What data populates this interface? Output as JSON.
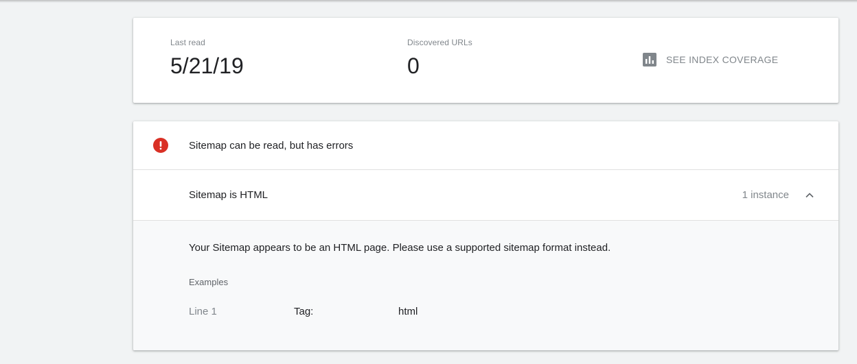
{
  "summary": {
    "last_read_label": "Last read",
    "last_read_value": "5/21/19",
    "discovered_label": "Discovered URLs",
    "discovered_value": "0",
    "coverage_link_label": "SEE INDEX COVERAGE",
    "coverage_icon": "bar-chart-icon"
  },
  "status": {
    "icon": "error-icon",
    "text": "Sitemap can be read, but has errors",
    "error_color": "#d93025"
  },
  "issue": {
    "title": "Sitemap is HTML",
    "count": "1 instance",
    "expanded": true,
    "toggle_icon": "chevron-up-icon",
    "description": "Your Sitemap appears to be an HTML page. Please use a supported sitemap format instead.",
    "examples_label": "Examples",
    "examples": [
      {
        "line": "Line 1",
        "tag_label": "Tag:",
        "tag_value": "html"
      }
    ]
  }
}
